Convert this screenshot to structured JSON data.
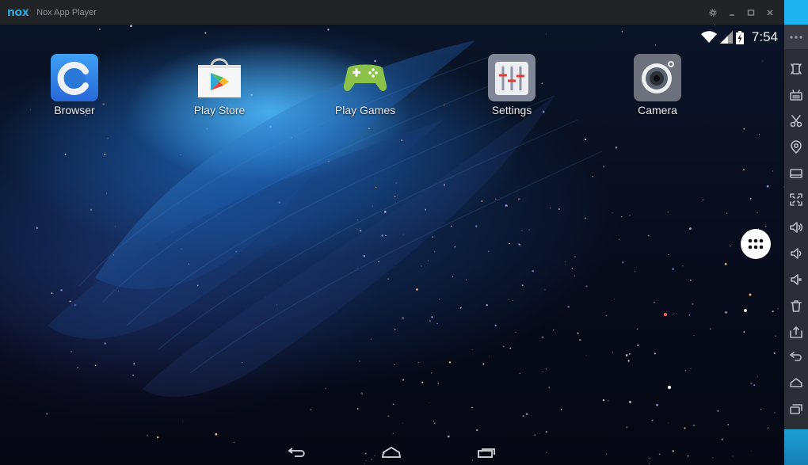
{
  "titlebar": {
    "logo": "nox",
    "title": "Nox App Player",
    "controls": [
      {
        "name": "settings",
        "icon": "gear-icon"
      },
      {
        "name": "minimize",
        "icon": "minimize-icon"
      },
      {
        "name": "maximize",
        "icon": "maximize-icon"
      },
      {
        "name": "close",
        "icon": "close-icon"
      }
    ]
  },
  "statusbar": {
    "wifi": "wifi-icon",
    "signal": "signal-icon",
    "battery": "battery-charging-icon",
    "time": "7:54"
  },
  "home": {
    "apps": [
      {
        "label": "Browser",
        "icon": "browser-icon"
      },
      {
        "label": "Play Store",
        "icon": "play-store-icon"
      },
      {
        "label": "Play Games",
        "icon": "play-games-icon"
      },
      {
        "label": "Settings",
        "icon": "settings-icon"
      },
      {
        "label": "Camera",
        "icon": "camera-icon"
      }
    ],
    "app_drawer": "app-drawer-icon"
  },
  "navbar": {
    "buttons": [
      {
        "name": "back",
        "icon": "back-icon"
      },
      {
        "name": "home",
        "icon": "home-icon"
      },
      {
        "name": "recents",
        "icon": "recents-icon"
      }
    ]
  },
  "sidebar": {
    "more": "more-icon",
    "items": [
      {
        "name": "rotate",
        "icon": "phone-rotate-icon"
      },
      {
        "name": "keyboard",
        "icon": "keyboard-icon"
      },
      {
        "name": "screenshot",
        "icon": "scissors-icon"
      },
      {
        "name": "location",
        "icon": "location-icon"
      },
      {
        "name": "screen-display",
        "icon": "display-icon"
      },
      {
        "name": "fullscreen",
        "icon": "fullscreen-icon"
      },
      {
        "name": "volume-up",
        "icon": "volume-up-icon"
      },
      {
        "name": "volume-down",
        "icon": "volume-down-icon"
      },
      {
        "name": "volume-mute",
        "icon": "volume-mute-icon"
      },
      {
        "name": "clean",
        "icon": "trash-icon"
      },
      {
        "name": "install-apk",
        "icon": "install-apk-icon"
      },
      {
        "name": "back",
        "icon": "back-icon"
      },
      {
        "name": "home",
        "icon": "home-icon"
      },
      {
        "name": "recents",
        "icon": "recents-icon"
      }
    ]
  },
  "colors": {
    "accent": "#1fb3f2",
    "titlebar_bg": "#222327",
    "sidebar_bg": "#2b2e35"
  }
}
